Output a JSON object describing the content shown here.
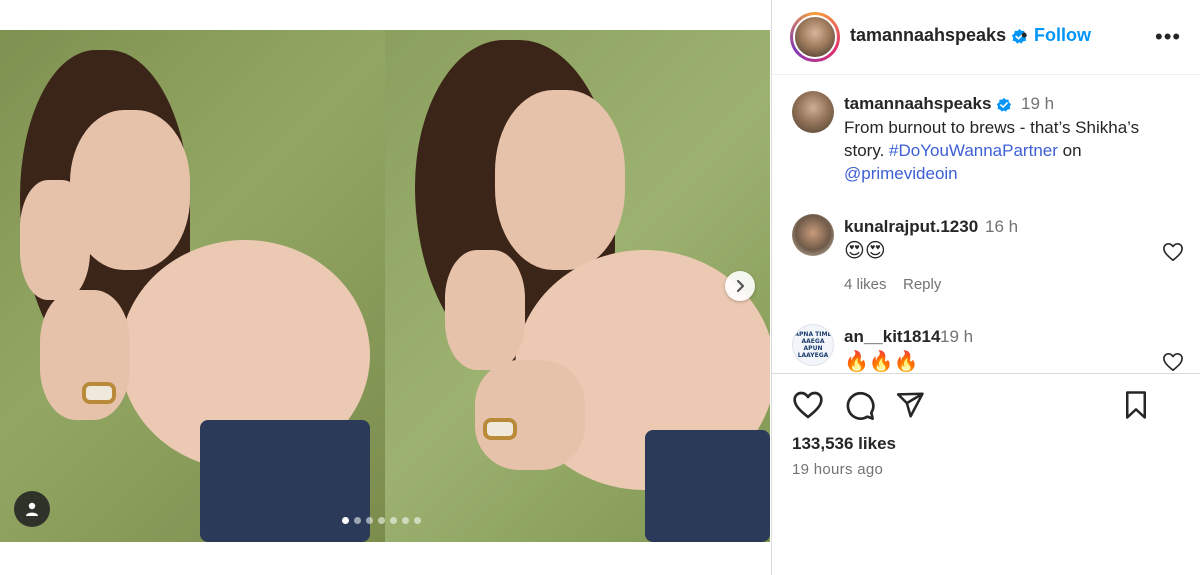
{
  "post": {
    "image_count": 7,
    "active_index": 0
  },
  "header": {
    "username": "tamannaahspeaks",
    "separator": "•",
    "follow_label": "Follow",
    "more_label": "•••"
  },
  "caption": {
    "username": "tamannaahspeaks",
    "time": "19 h",
    "text_before": "From burnout to brews - that’s Shikha’s story. ",
    "hashtag": "#DoYouWannaPartner",
    "text_middle": " on",
    "mention": "@primevideoin"
  },
  "comments": [
    {
      "username": "kunalrajput.1230",
      "time": "16 h",
      "text": "😍😍",
      "likes": "4 likes",
      "reply_label": "Reply"
    },
    {
      "username": "an__kit1814",
      "time": "19 h",
      "text": "🔥🔥🔥",
      "avatar_text": "APNA TIME AAEGA APUN LAAYEGA"
    }
  ],
  "footer": {
    "likes": "133,536 likes",
    "time_ago": "19 hours ago"
  },
  "colors": {
    "accent": "#0095f6",
    "verified": "#0095f6",
    "backdrop": "#8a9b5c"
  },
  "icons": {
    "like": "heart-icon",
    "comment": "comment-icon",
    "share": "share-icon",
    "save": "bookmark-icon",
    "next": "chevron-right-icon",
    "tags": "user-tag-icon"
  }
}
